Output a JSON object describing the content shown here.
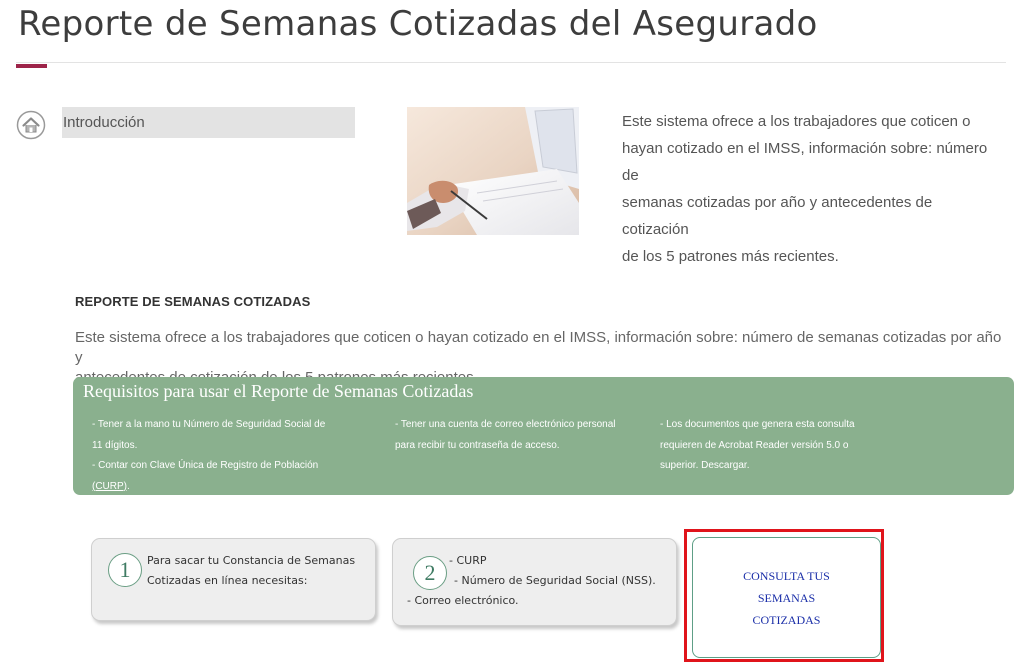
{
  "header": {
    "title": "Reporte de Semanas Cotizadas del Asegurado",
    "accent_color": "#9d2449"
  },
  "sidebar": {
    "home_icon": "home-icon",
    "items": [
      {
        "label": "Introducción"
      }
    ]
  },
  "intro": {
    "lines": [
      "Este sistema ofrece a los trabajadores que coticen o",
      "hayan cotizado en el IMSS, información sobre: número de",
      "semanas cotizadas por año y antecedentes de cotización",
      "de los 5 patrones más recientes."
    ]
  },
  "section": {
    "heading": "REPORTE DE SEMANAS COTIZADAS",
    "lines": [
      "Este sistema ofrece a los trabajadores que coticen o hayan cotizado en el IMSS, información sobre: número de semanas cotizadas por año y",
      "antecedentes de cotización de los 5 patrones más recientes."
    ]
  },
  "requirements": {
    "title": "Requisitos para usar el Reporte de Semanas Cotizadas",
    "panel_color": "#8ab08e",
    "col1": {
      "lines": [
        "- Tener a la mano tu Número de Seguridad Social de",
        "11 dígitos.",
        "- Contar con Clave Única de Registro de Población"
      ],
      "curp_link": "(CURP)",
      "after_link": "."
    },
    "col2": {
      "lines": [
        "- Tener una cuenta de correo electrónico personal",
        "para recibir tu contraseña de acceso."
      ]
    },
    "col3": {
      "lines": [
        "- Los documentos que genera esta consulta",
        "requieren de Acrobat Reader versión 5.0 o",
        "superior. Descargar."
      ]
    }
  },
  "steps": [
    {
      "number": "1",
      "lines": [
        "Para sacar tu Constancia de Semanas",
        "Cotizadas en línea necesitas:"
      ]
    },
    {
      "number": "2",
      "lines": [
        "- CURP",
        "- Número de Seguridad Social (NSS).",
        "- Correo electrónico."
      ]
    }
  ],
  "consulta": {
    "lines": [
      "CONSULTA TUS",
      "SEMANAS",
      "COTIZADAS"
    ],
    "text_color": "#1a2ea8",
    "highlight_color": "#e0141b"
  }
}
